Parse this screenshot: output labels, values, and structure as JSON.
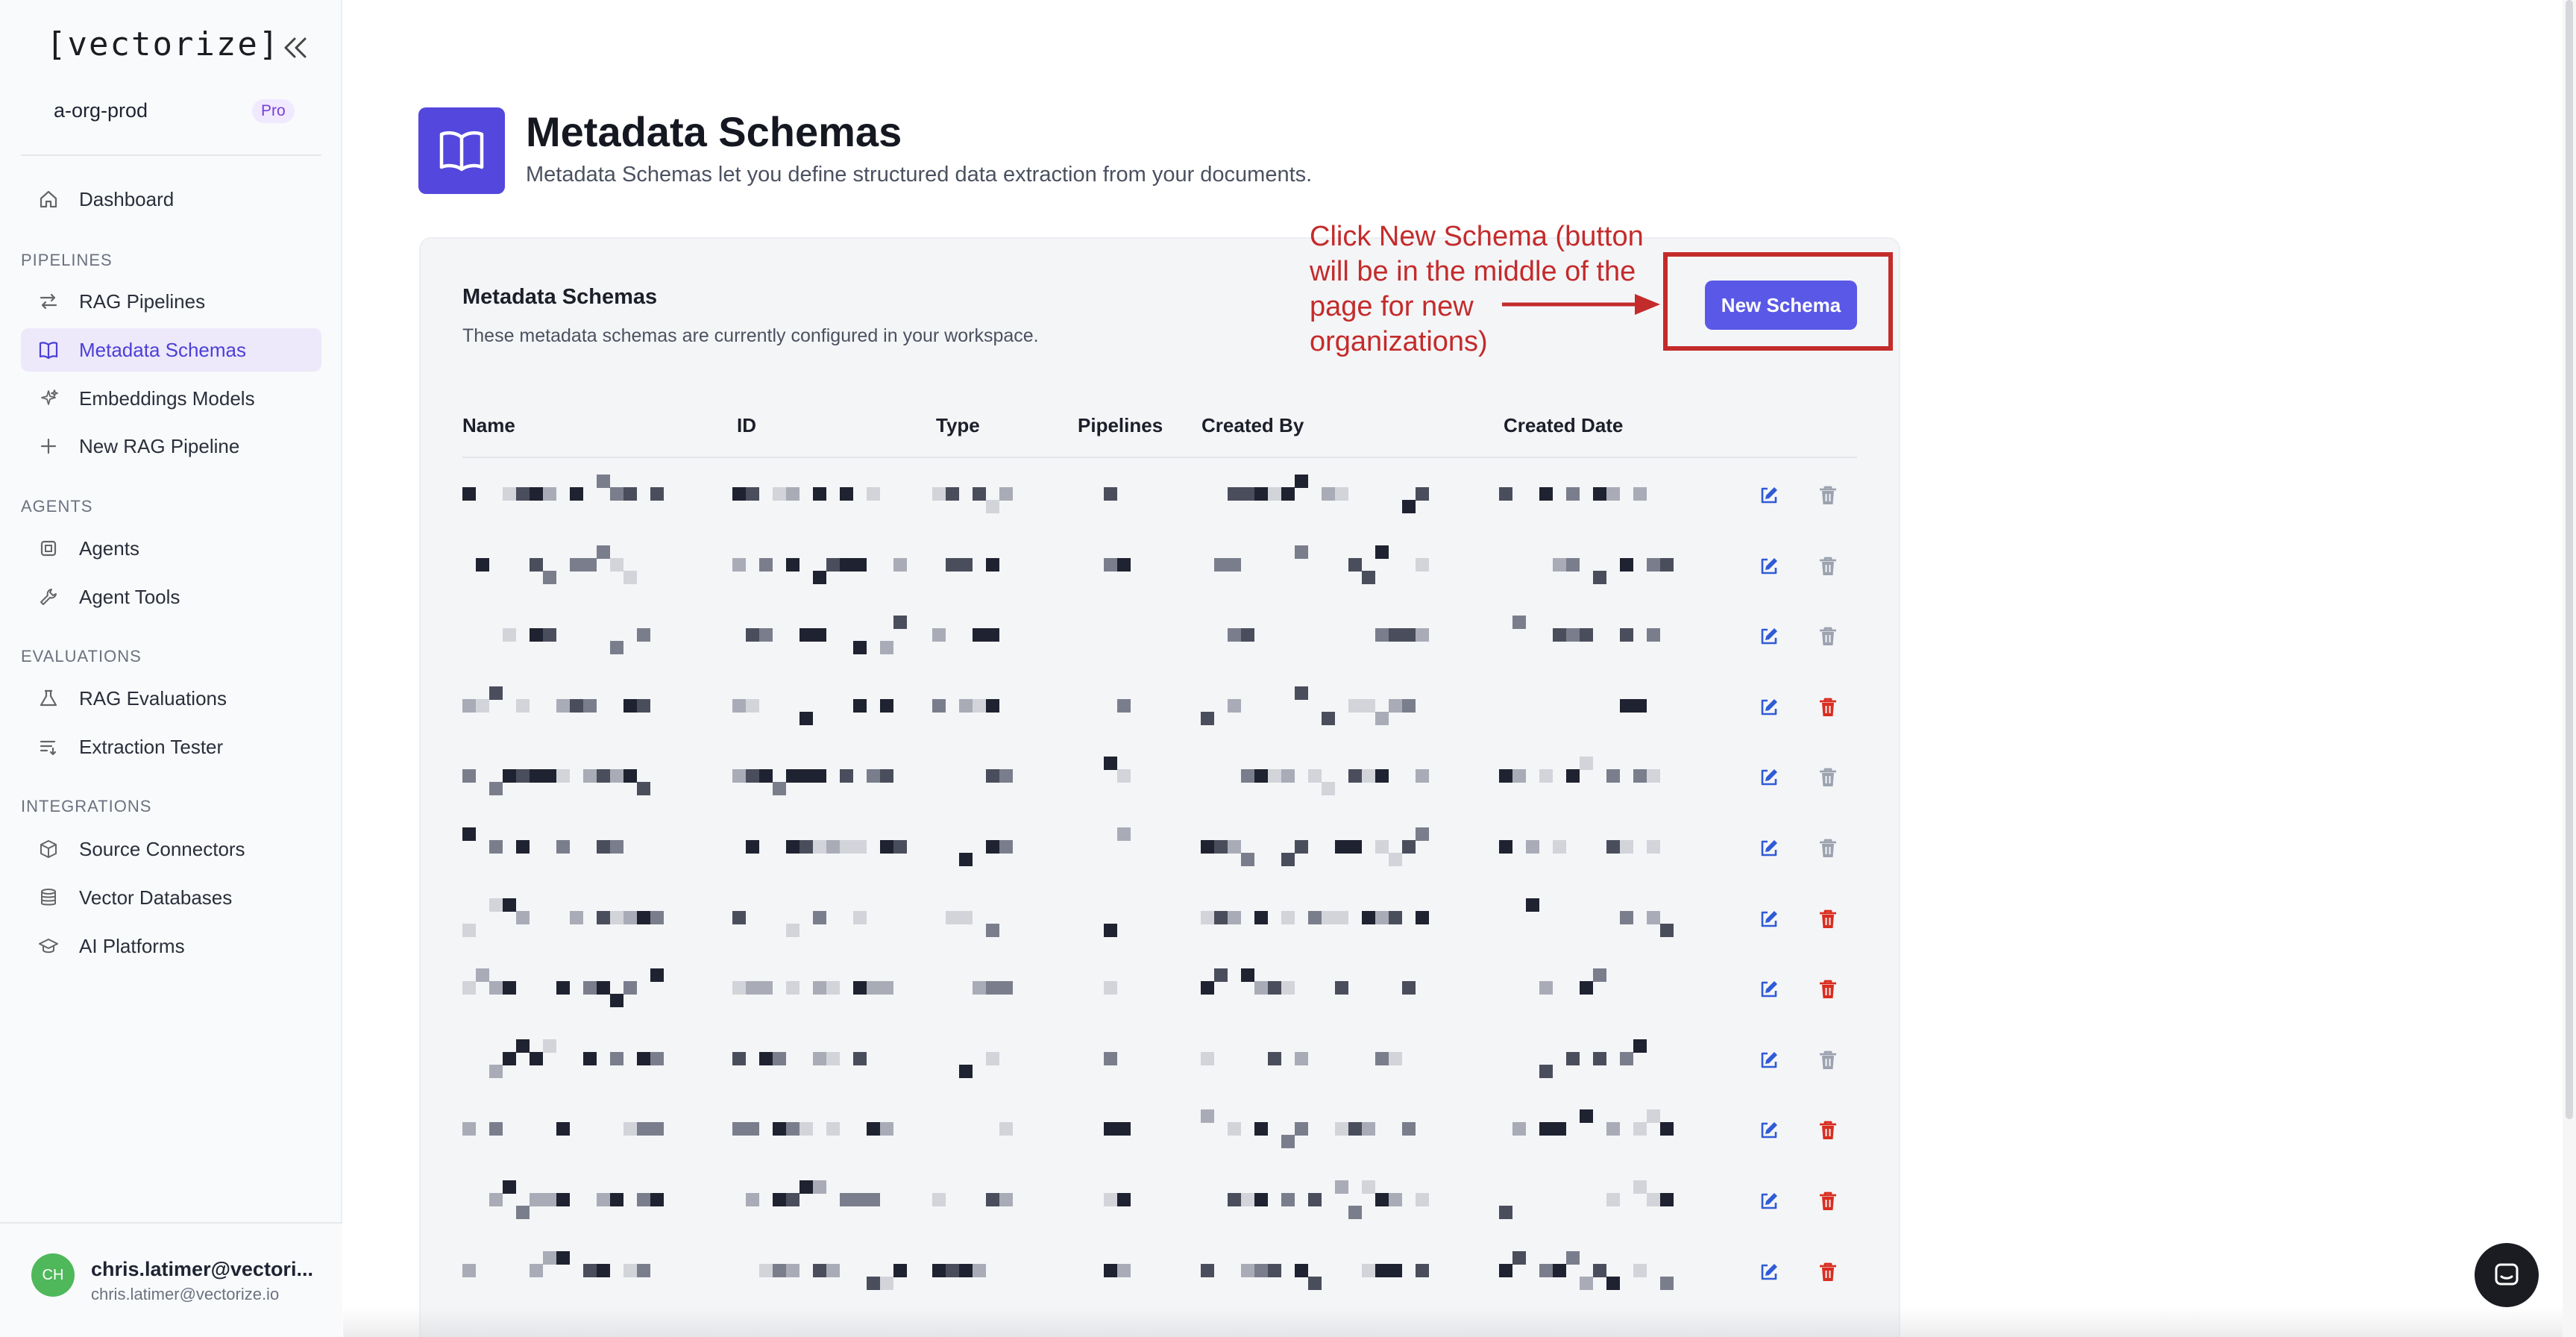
{
  "brand": "[vectorize]",
  "org": {
    "name": "a-org-prod",
    "plan": "Pro"
  },
  "sidebar": {
    "dashboard": "Dashboard",
    "sections": [
      {
        "title": "PIPELINES",
        "items": [
          "RAG Pipelines",
          "Metadata Schemas",
          "Embeddings Models",
          "New RAG Pipeline"
        ]
      },
      {
        "title": "AGENTS",
        "items": [
          "Agents",
          "Agent Tools"
        ]
      },
      {
        "title": "EVALUATIONS",
        "items": [
          "RAG Evaluations",
          "Extraction Tester"
        ]
      },
      {
        "title": "INTEGRATIONS",
        "items": [
          "Source Connectors",
          "Vector Databases",
          "AI Platforms"
        ]
      }
    ],
    "active": "Metadata Schemas"
  },
  "user": {
    "initials": "CH",
    "name": "chris.latimer@vectori...",
    "email": "chris.latimer@vectorize.io"
  },
  "page": {
    "title": "Metadata Schemas",
    "subtitle": "Metadata Schemas let you define structured data extraction from your documents."
  },
  "card": {
    "title": "Metadata Schemas",
    "subtitle": "These metadata schemas are currently configured in your workspace.",
    "new_button": "New Schema",
    "columns": [
      "Name",
      "ID",
      "Type",
      "Pipelines",
      "Created By",
      "Created Date"
    ]
  },
  "annotation": "Click New Schema (button will be in the middle of the page for new organizations)",
  "rows": [
    {
      "delete_enabled": false
    },
    {
      "delete_enabled": false
    },
    {
      "delete_enabled": false
    },
    {
      "delete_enabled": true
    },
    {
      "delete_enabled": false
    },
    {
      "delete_enabled": false
    },
    {
      "delete_enabled": true
    },
    {
      "delete_enabled": true
    },
    {
      "delete_enabled": false
    },
    {
      "delete_enabled": true
    },
    {
      "delete_enabled": true
    },
    {
      "delete_enabled": true
    }
  ],
  "colors": {
    "accent": "#5a58e6",
    "annotation": "#c42b2b",
    "delete_active": "#d92d20",
    "delete_disabled": "#9ca3af",
    "edit": "#2f5bd6"
  }
}
